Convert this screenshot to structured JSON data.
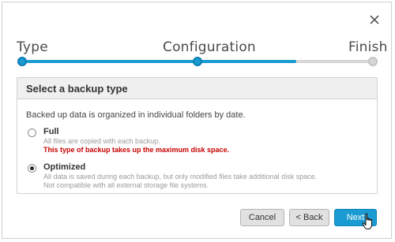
{
  "wizard": {
    "steps": [
      {
        "label": "Type",
        "state": "done"
      },
      {
        "label": "Configuration",
        "state": "current"
      },
      {
        "label": "Finish",
        "state": "pending"
      }
    ],
    "progress_fraction": 0.78,
    "accent_color": "#1a9bd2"
  },
  "panel": {
    "title": "Select a backup type",
    "description": "Backed up data is organized in individual folders by date.",
    "options": [
      {
        "title": "Full",
        "selected": false,
        "details": [
          "All files are copied with each backup."
        ],
        "warning": "This type of backup takes up the maximum disk space."
      },
      {
        "title": "Optimized",
        "selected": true,
        "details": [
          "All data is saved during each backup, but only modified files take additional disk space.",
          "Not compatible with all external storage file systems."
        ]
      }
    ]
  },
  "buttons": {
    "cancel": "Cancel",
    "back": "< Back",
    "next": "Next"
  },
  "icons": {
    "close": "close-icon",
    "cursor": "hand-pointer-icon"
  },
  "colors": {
    "warning": "#c80000"
  }
}
